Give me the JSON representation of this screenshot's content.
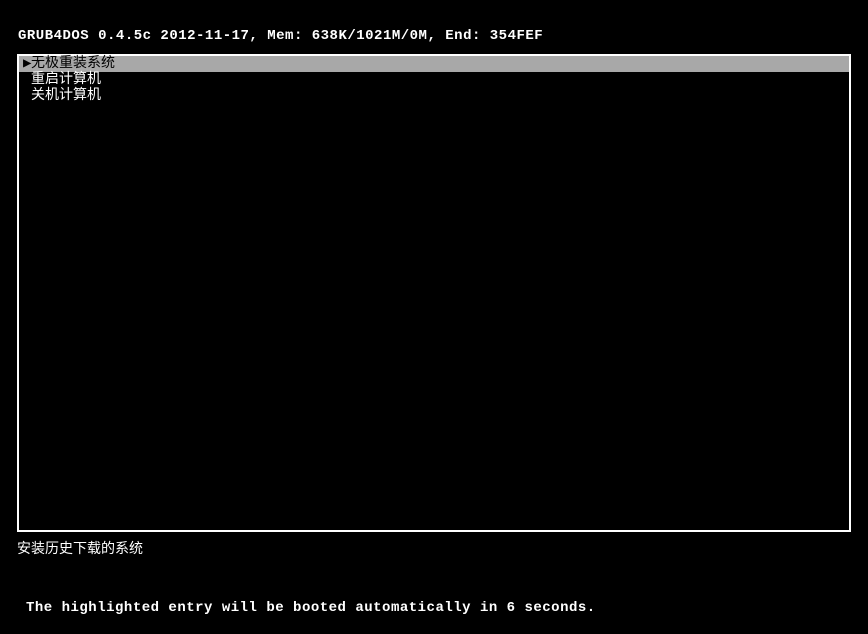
{
  "header": "GRUB4DOS 0.4.5c 2012-11-17, Mem: 638K/1021M/0M, End: 354FEF",
  "menu": {
    "items": [
      {
        "label": "无极重装系统",
        "selected": true
      },
      {
        "label": "重启计算机",
        "selected": false
      },
      {
        "label": "关机计算机",
        "selected": false
      }
    ]
  },
  "description": "安装历史下载的系统",
  "footer": "The highlighted entry will be booted automatically in 6 seconds."
}
